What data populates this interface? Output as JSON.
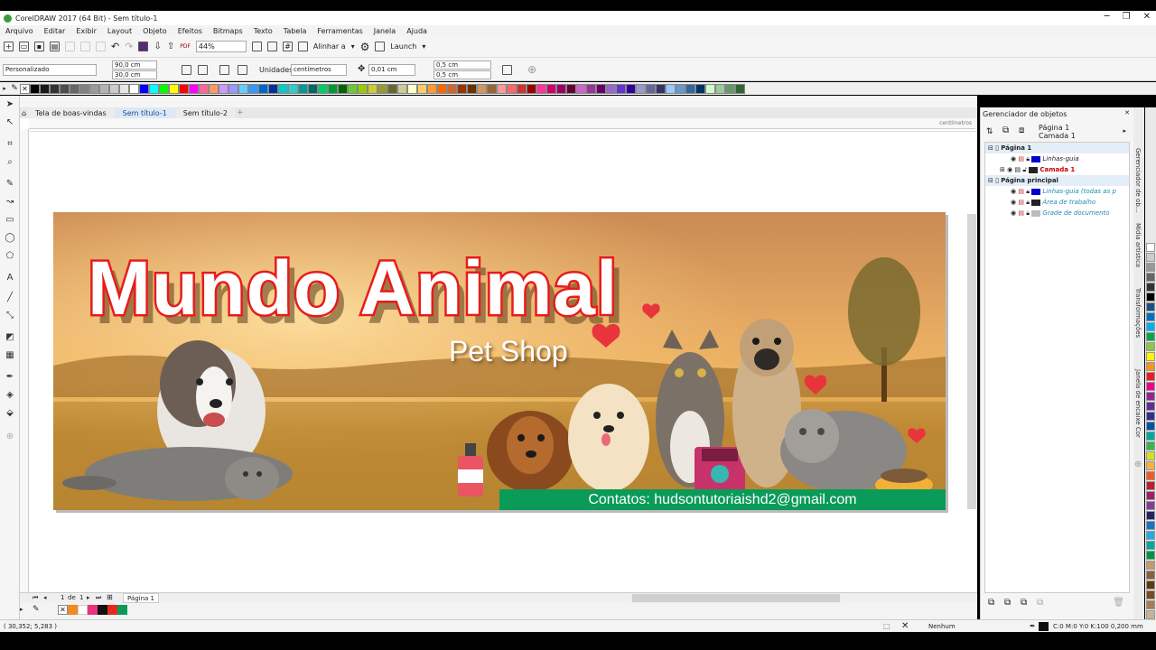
{
  "title_bar": {
    "title": "CorelDRAW 2017 (64 Bit) - Sem título-1"
  },
  "menu": [
    "Arquivo",
    "Editar",
    "Exibir",
    "Layout",
    "Objeto",
    "Efeitos",
    "Bitmaps",
    "Texto",
    "Tabela",
    "Ferramentas",
    "Janela",
    "Ajuda"
  ],
  "toolbar": {
    "zoom": "44%",
    "align_label": "Alinhar a",
    "launch_label": "Launch",
    "pdf_label": "PDF"
  },
  "property_bar": {
    "page_preset": "Personalizado",
    "width": "90,0 cm",
    "height": "30,0 cm",
    "units_label": "Unidades:",
    "units_value": "centímetros",
    "nudge": "0,01 cm",
    "dup_x": "0,5 cm",
    "dup_y": "0,5 cm"
  },
  "palette_colors": [
    "#000000",
    "#1a1a1a",
    "#333333",
    "#4d4d4d",
    "#666666",
    "#808080",
    "#999999",
    "#b3b3b3",
    "#cccccc",
    "#e6e6e6",
    "#ffffff",
    "#0000ff",
    "#00ffff",
    "#00ff00",
    "#ffff00",
    "#ff0000",
    "#ff00ff",
    "#ff6699",
    "#ff9966",
    "#cc99ff",
    "#9999ff",
    "#66ccff",
    "#3399ff",
    "#0066cc",
    "#003399",
    "#00cccc",
    "#33cccc",
    "#009999",
    "#006666",
    "#00cc66",
    "#009933",
    "#006600",
    "#66cc33",
    "#99cc00",
    "#cccc33",
    "#999933",
    "#666633",
    "#cccc99",
    "#ffffcc",
    "#ffcc66",
    "#ff9933",
    "#ff6600",
    "#cc6633",
    "#993300",
    "#663300",
    "#cc9966",
    "#996633",
    "#ff9999",
    "#ff6666",
    "#cc3333",
    "#990000",
    "#ff3399",
    "#cc0066",
    "#990066",
    "#660033",
    "#cc66cc",
    "#993399",
    "#660066",
    "#9966cc",
    "#6633cc",
    "#330099",
    "#9999cc",
    "#666699",
    "#333366",
    "#99ccff",
    "#6699cc",
    "#336699",
    "#003366",
    "#ccffcc",
    "#99cc99",
    "#669966",
    "#336633"
  ],
  "tabs": [
    "Tela de boas-vindas",
    "Sem título-1",
    "Sem título-2"
  ],
  "ruler_unit": "centímetros",
  "banner": {
    "title": "Mundo Animal",
    "subtitle": "Pet Shop",
    "contact": "Contatos: hudsontutoriaishd2@gmail.com"
  },
  "page_nav": {
    "current": "1",
    "of": "de",
    "total": "1",
    "page_tab": "Página 1"
  },
  "status": {
    "coords": "( 30,352; 5,283 )",
    "fill": "Nenhum",
    "outline": "C:0 M:0 Y:0 K:100  0,200 mm"
  },
  "object_manager": {
    "title": "Gerenciador de objetos",
    "current_page": "Página 1",
    "current_layer": "Camada 1",
    "rows": [
      {
        "label": "Página 1",
        "bold": true,
        "color": ""
      },
      {
        "label": "Linhas-guia",
        "italic": true,
        "color": "#0000cc"
      },
      {
        "label": "Camada 1",
        "bold": true,
        "color": "#cc0000",
        "text_color": "#cc0000"
      },
      {
        "label": "Página principal",
        "bold": true,
        "color": ""
      },
      {
        "label": "Linhas-guia (todas as p",
        "italic": true,
        "color": "#0000cc",
        "text_color": "#1a8cb0"
      },
      {
        "label": "Área de trabalho",
        "italic": true,
        "color": "#222222",
        "text_color": "#1a8cb0"
      },
      {
        "label": "Grade de documento",
        "italic": true,
        "color": "#bbbbbb",
        "text_color": "#1a8cb0"
      }
    ]
  },
  "side_tabs": [
    "Gerenciador de ob...",
    "Mídia artística",
    "Transformações",
    "Janela de encaixe Cor"
  ]
}
